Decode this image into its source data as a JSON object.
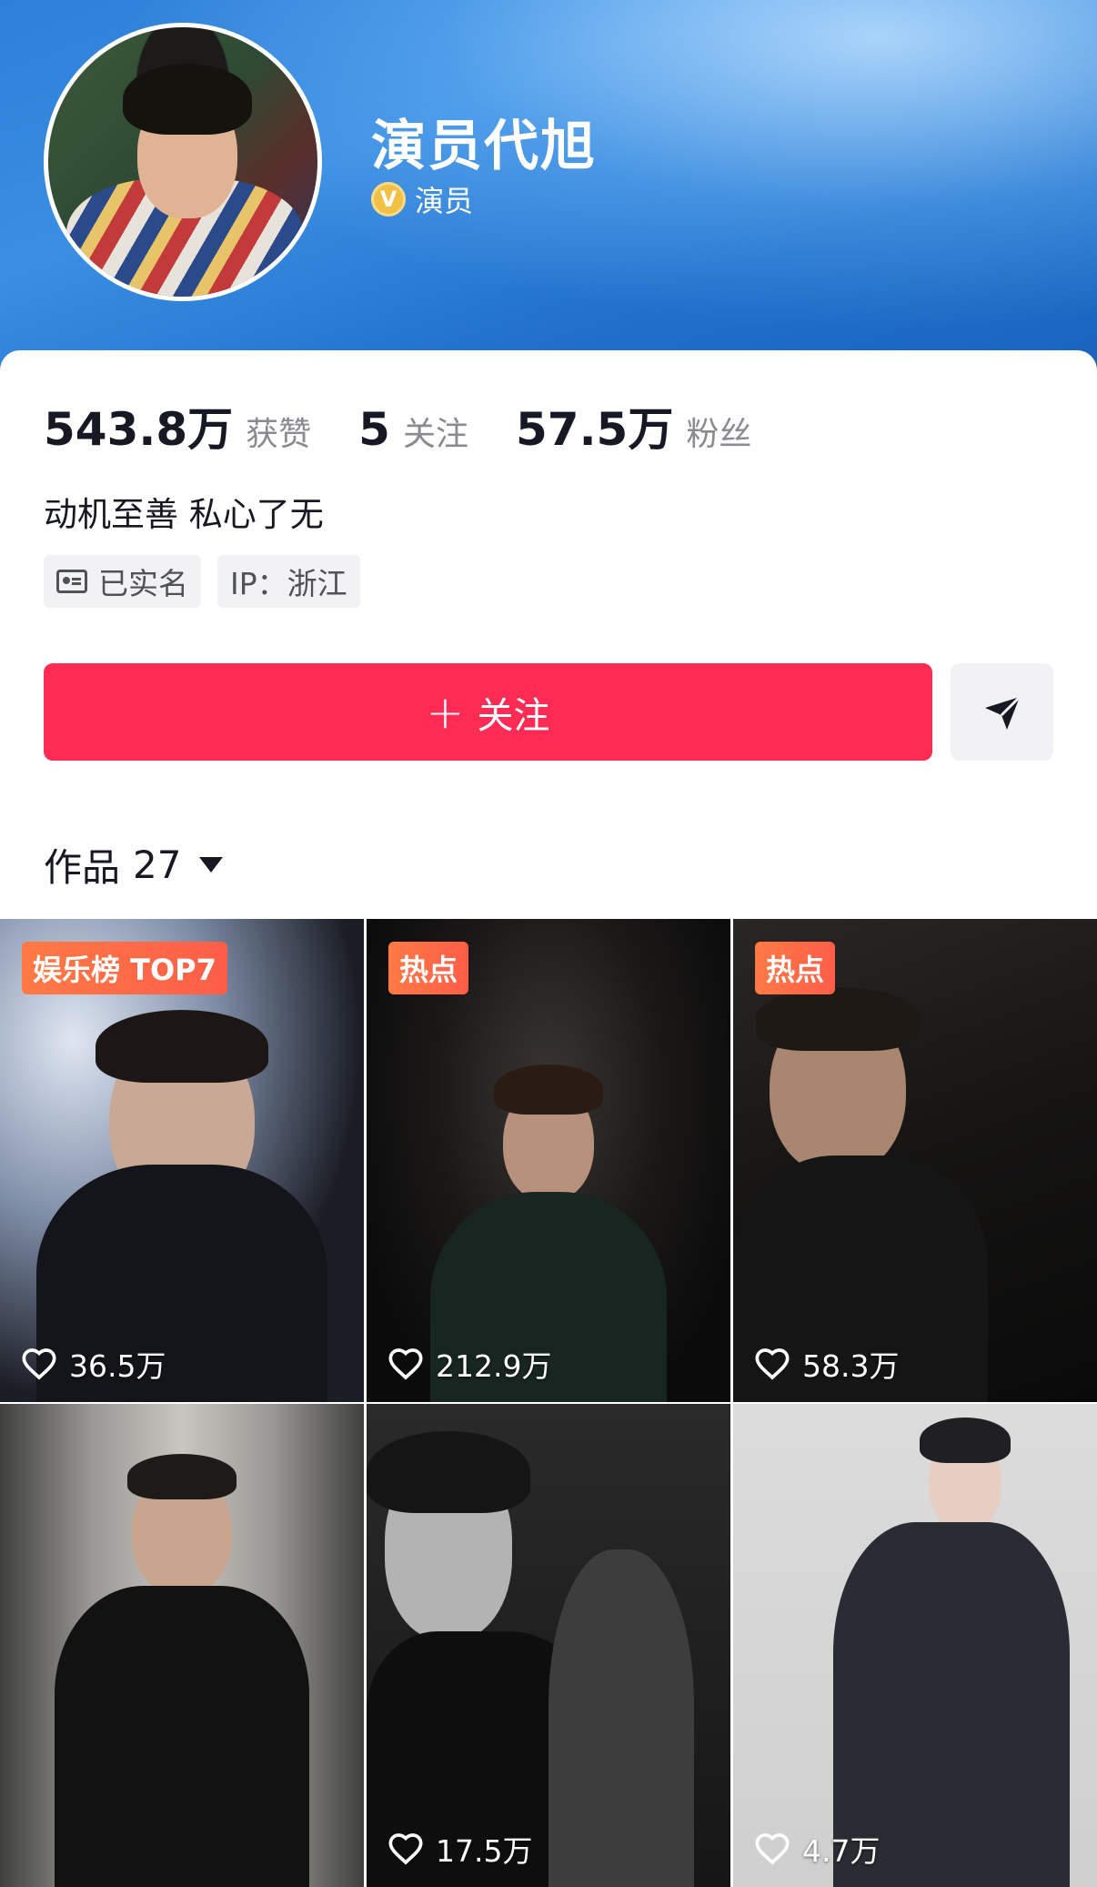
{
  "profile": {
    "name": "演员代旭",
    "verify_icon_text": "V",
    "verify_label": "演员",
    "bio": "动机至善 私心了无"
  },
  "stats": [
    {
      "value": "543.8万",
      "label": "获赞"
    },
    {
      "value": "5",
      "label": "关注"
    },
    {
      "value": "57.5万",
      "label": "粉丝"
    }
  ],
  "tags": {
    "verified_name": "已实名",
    "ip": "IP：浙江"
  },
  "actions": {
    "follow_plus": "+",
    "follow_label": "关注"
  },
  "works": {
    "label": "作品",
    "count": "27"
  },
  "videos": [
    {
      "badge": "娱乐榜 TOP7",
      "likes": "36.5万"
    },
    {
      "badge": "热点",
      "likes": "212.9万"
    },
    {
      "badge": "热点",
      "likes": "58.3万"
    },
    {
      "badge": "",
      "likes": ""
    },
    {
      "badge": "",
      "likes": "17.5万"
    },
    {
      "badge": "",
      "likes": "4.7万"
    }
  ],
  "colors": {
    "follow_button": "#fe2c55",
    "header_blue": "#2d7fd8",
    "badge_orange": "#ff6d47",
    "verify_gold": "#f3c046"
  }
}
